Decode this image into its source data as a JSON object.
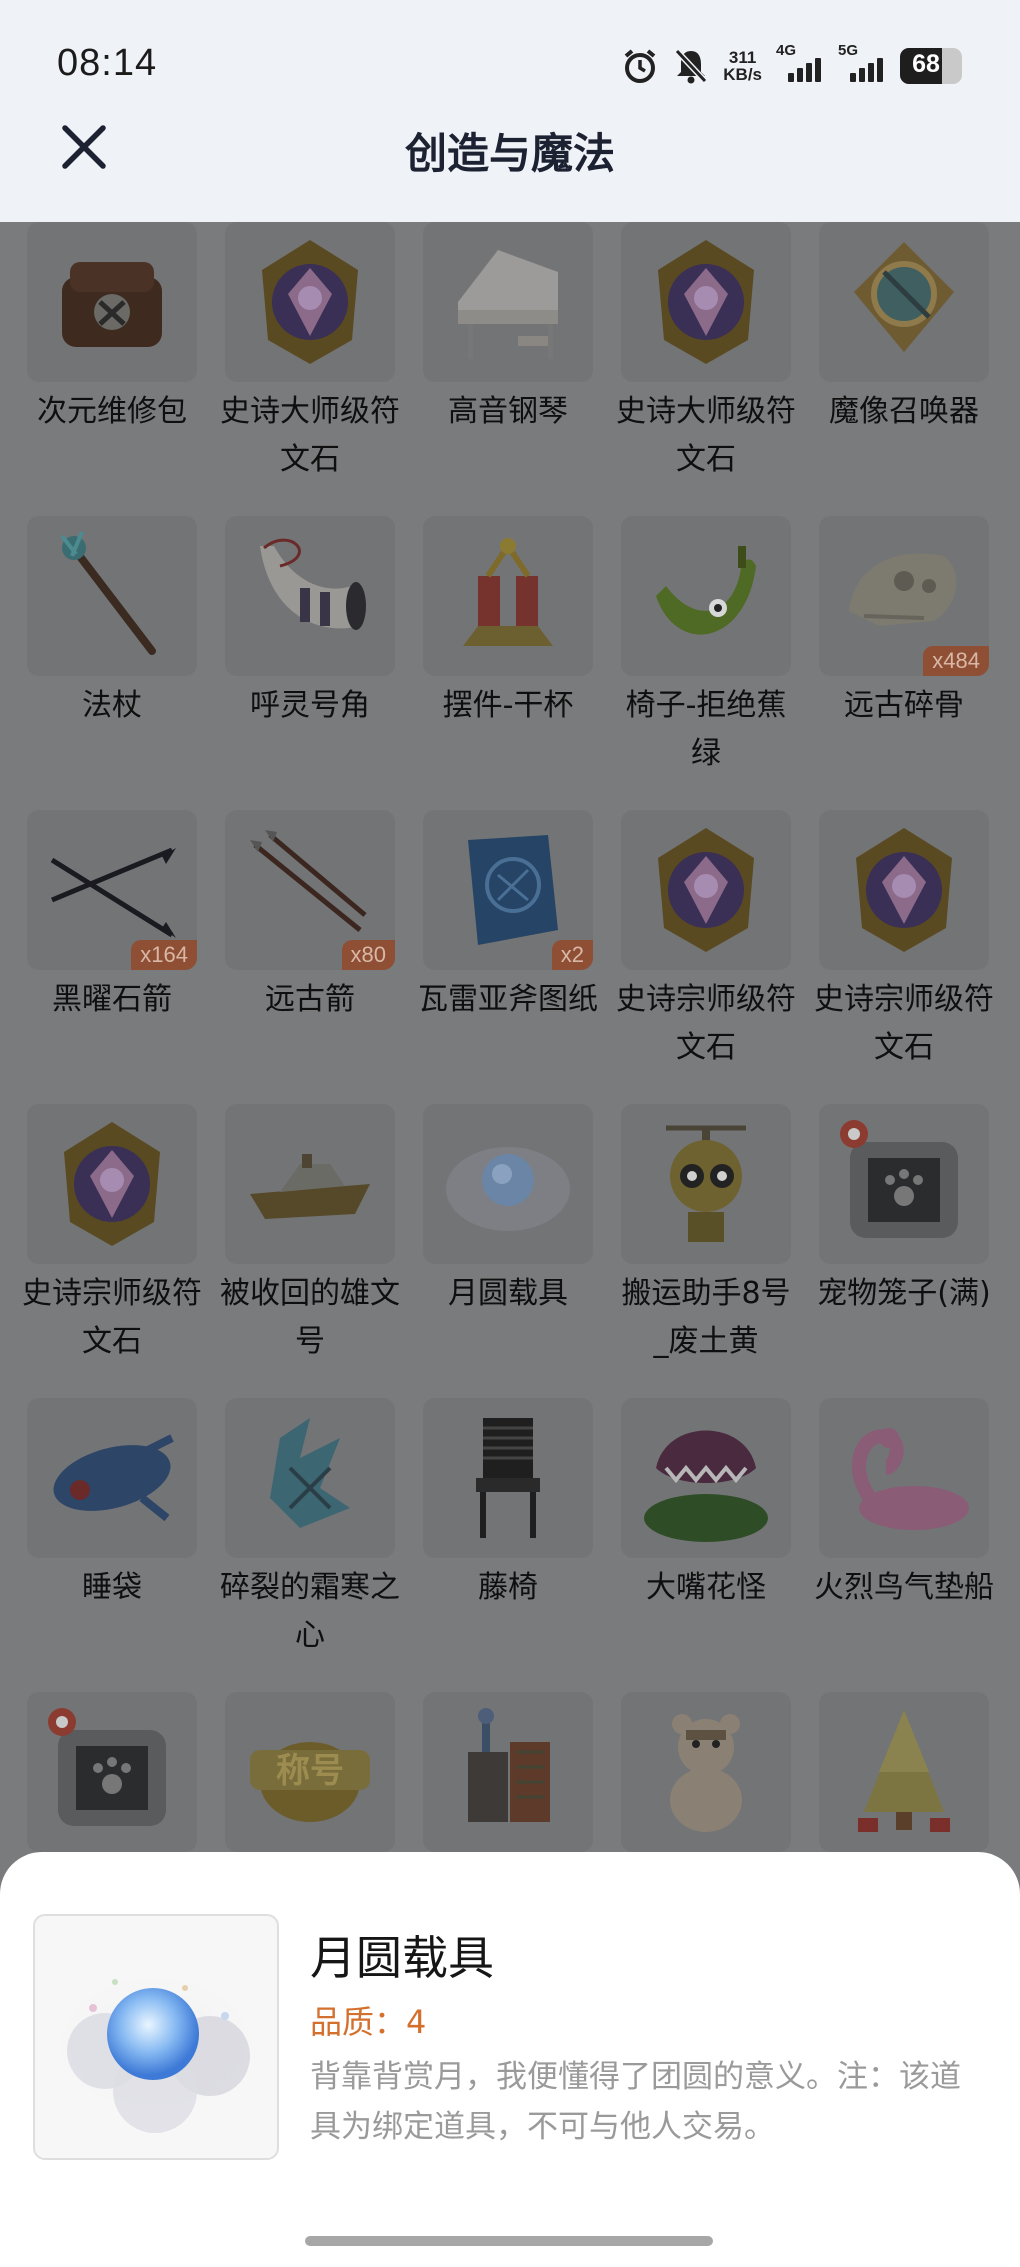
{
  "status": {
    "time": "08:14",
    "speed_value": "311",
    "speed_unit": "KB/s",
    "network_1": "4G",
    "network_2": "5G",
    "battery": "68"
  },
  "header": {
    "title": "创造与魔法"
  },
  "grid": {
    "items": [
      {
        "name": "次元维修包",
        "icon": "bag-icon"
      },
      {
        "name": "史诗大师级符文石",
        "icon": "rune-stone-icon"
      },
      {
        "name": "高音钢琴",
        "icon": "piano-icon"
      },
      {
        "name": "史诗大师级符文石",
        "icon": "rune-stone-icon"
      },
      {
        "name": "魔像召唤器",
        "icon": "golem-summoner-icon"
      },
      {
        "name": "法杖",
        "icon": "staff-icon"
      },
      {
        "name": "呼灵号角",
        "icon": "horn-icon"
      },
      {
        "name": "摆件-干杯",
        "icon": "cheers-ornament-icon"
      },
      {
        "name": "椅子-拒绝蕉绿",
        "icon": "banana-chair-icon"
      },
      {
        "name": "远古碎骨",
        "icon": "skull-icon",
        "count": "x484"
      },
      {
        "name": "黑曜石箭",
        "icon": "obsidian-arrow-icon",
        "count": "x164"
      },
      {
        "name": "远古箭",
        "icon": "ancient-arrow-icon",
        "count": "x80"
      },
      {
        "name": "瓦雷亚斧图纸",
        "icon": "blueprint-icon",
        "count": "x2"
      },
      {
        "name": "史诗宗师级符文石",
        "icon": "rune-stone-icon"
      },
      {
        "name": "史诗宗师级符文石",
        "icon": "rune-stone-icon"
      },
      {
        "name": "史诗宗师级符文石",
        "icon": "rune-stone-icon"
      },
      {
        "name": "被收回的雄文号",
        "icon": "ship-icon"
      },
      {
        "name": "月圆载具",
        "icon": "moon-vehicle-icon"
      },
      {
        "name": "搬运助手8号_废土黄",
        "icon": "robot-icon"
      },
      {
        "name": "宠物笼子(满)",
        "icon": "pet-cage-icon"
      },
      {
        "name": "睡袋",
        "icon": "sleeping-bag-icon"
      },
      {
        "name": "碎裂的霜寒之心",
        "icon": "frost-heart-icon"
      },
      {
        "name": "藤椅",
        "icon": "rattan-chair-icon"
      },
      {
        "name": "大嘴花怪",
        "icon": "plant-monster-icon"
      },
      {
        "name": "火烈鸟气垫船",
        "icon": "flamingo-float-icon"
      },
      {
        "name": "",
        "icon": "pet-cage-icon"
      },
      {
        "name": "",
        "icon": "title-badge-icon",
        "text": "称号"
      },
      {
        "name": "",
        "icon": "machine-icon"
      },
      {
        "name": "",
        "icon": "teddy-bear-icon"
      },
      {
        "name": "",
        "icon": "christmas-tree-icon"
      }
    ]
  },
  "detail": {
    "name": "月圆载具",
    "quality": "品质：4",
    "description": "背靠背赏月，我便懂得了团圆的意义。注：该道具为绑定道具，不可与他人交易。"
  },
  "colors": {
    "quality": "#d4702e",
    "badge": "#8e4f34",
    "overlay": "#7a7b7d"
  }
}
